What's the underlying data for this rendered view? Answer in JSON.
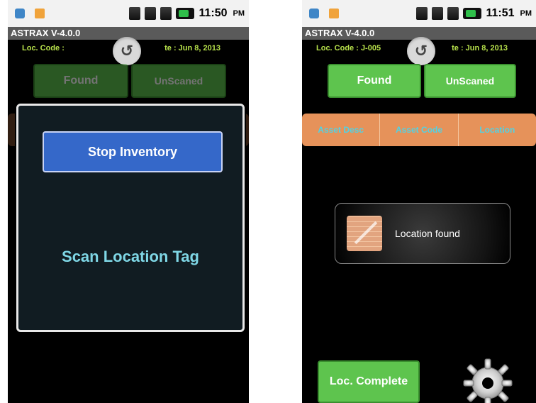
{
  "left": {
    "status": {
      "time": "11:50",
      "ampm": "PM"
    },
    "title": "ASTRAX V-4.0.0",
    "info": {
      "loc_code": "Loc. Code :",
      "date": "te : Jun 8, 2013"
    },
    "buttons": {
      "found": "Found",
      "unscaned": "UnScaned"
    },
    "dialog": {
      "button": "Stop Inventory",
      "message": "Scan Location Tag"
    }
  },
  "right": {
    "status": {
      "time": "11:51",
      "ampm": "PM"
    },
    "title": "ASTRAX V-4.0.0",
    "info": {
      "loc_code": "Loc. Code : J-005",
      "date": "te : Jun 8, 2013"
    },
    "buttons": {
      "found": "Found",
      "unscaned": "UnScaned"
    },
    "table_headers": [
      "Asset Desc",
      "Asset Code",
      "Location"
    ],
    "toast": "Location found",
    "loc_complete": "Loc. Complete"
  },
  "colors": {
    "green": "#5ec44e",
    "blue": "#3568c9",
    "orange": "#e6925a",
    "cyan": "#4fd3e6"
  },
  "icons": {
    "usb": "usb-icon",
    "sd": "sd-card-icon",
    "signal": "signal-icon",
    "battery": "battery-icon",
    "back": "back-arrow-icon",
    "gear": "gear-icon"
  }
}
